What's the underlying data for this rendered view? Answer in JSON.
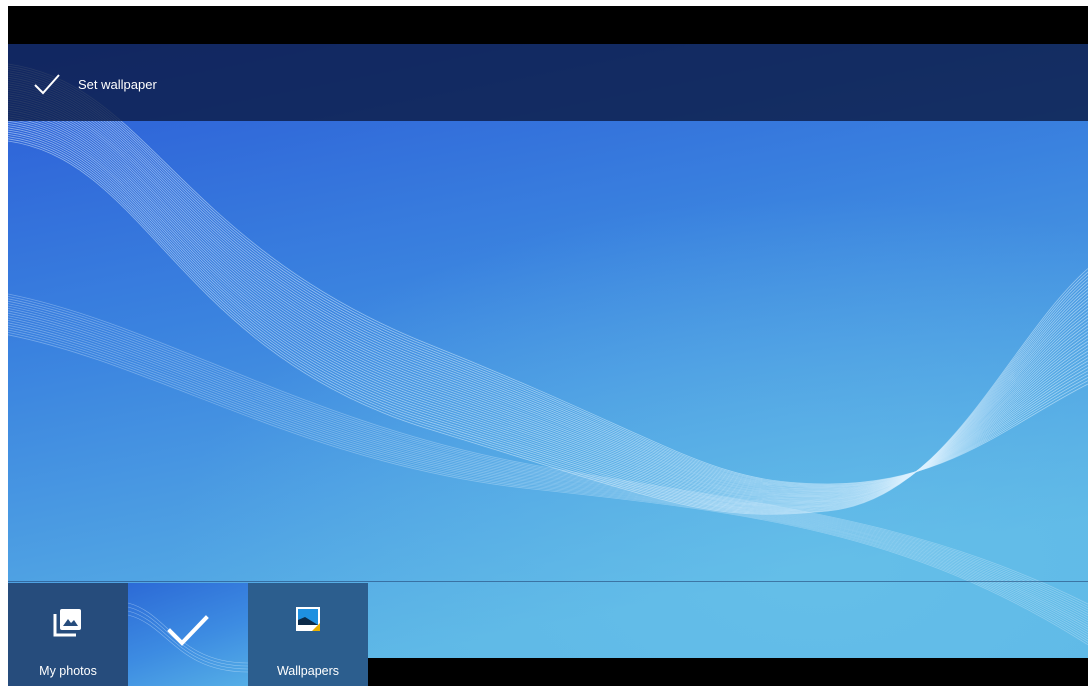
{
  "action_bar": {
    "set_wallpaper_label": "Set wallpaper",
    "icon": "checkmark-icon"
  },
  "tray": {
    "items": [
      {
        "label": "My photos",
        "icon": "photo-library-icon"
      },
      {
        "label": "",
        "icon": "selected-checkmark-icon",
        "selected": true
      },
      {
        "label": "Wallpapers",
        "icon": "wallpaper-icon"
      }
    ]
  },
  "colors": {
    "wallpaper_top": "#2f63d6",
    "wallpaper_bottom": "#5ab3e6",
    "action_bar": "#0a1840",
    "tile_photos": "#264c7c",
    "tile_wallpapers": "#2c5e8e"
  }
}
